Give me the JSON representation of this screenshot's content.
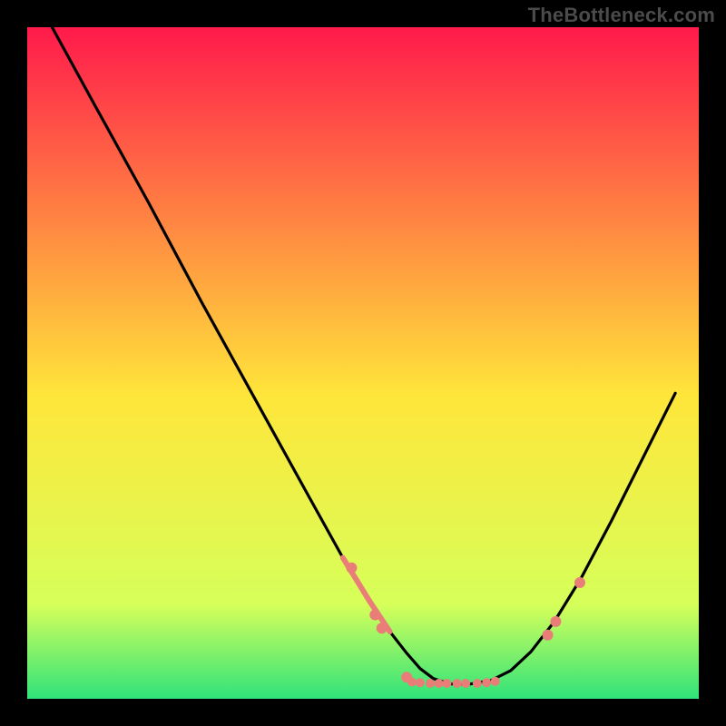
{
  "watermark": "TheBottleneck.com",
  "chart_data": {
    "type": "line",
    "title": "",
    "xlabel": "",
    "ylabel": "",
    "xlim": [
      0,
      100
    ],
    "ylim": [
      0,
      100
    ],
    "grid": false,
    "legend": false,
    "background_gradient_top": "#ff1a4b",
    "background_gradient_mid": "#ffe63a",
    "background_gradient_bottom": "#2fe37a",
    "curve_color": "#000000",
    "curve": [
      {
        "x": 3.7,
        "y": 100.0
      },
      {
        "x": 10.0,
        "y": 88.5
      },
      {
        "x": 18.0,
        "y": 74.0
      },
      {
        "x": 26.0,
        "y": 59.0
      },
      {
        "x": 34.0,
        "y": 44.5
      },
      {
        "x": 42.0,
        "y": 30.0
      },
      {
        "x": 47.0,
        "y": 21.0
      },
      {
        "x": 51.0,
        "y": 14.5
      },
      {
        "x": 54.0,
        "y": 10.0
      },
      {
        "x": 56.5,
        "y": 6.8
      },
      {
        "x": 58.5,
        "y": 4.5
      },
      {
        "x": 60.5,
        "y": 3.0
      },
      {
        "x": 63.0,
        "y": 2.2
      },
      {
        "x": 66.0,
        "y": 2.2
      },
      {
        "x": 69.0,
        "y": 2.7
      },
      {
        "x": 72.0,
        "y": 4.2
      },
      {
        "x": 75.0,
        "y": 7.0
      },
      {
        "x": 78.5,
        "y": 11.5
      },
      {
        "x": 82.5,
        "y": 18.0
      },
      {
        "x": 87.0,
        "y": 26.5
      },
      {
        "x": 91.5,
        "y": 35.5
      },
      {
        "x": 96.5,
        "y": 45.5
      }
    ],
    "scatter_color": "#e97d78",
    "scatter_points": [
      {
        "x": 48.3,
        "y": 19.5,
        "r": 6
      },
      {
        "x": 51.8,
        "y": 12.5,
        "r": 6
      },
      {
        "x": 52.8,
        "y": 10.5,
        "r": 6
      },
      {
        "x": 56.5,
        "y": 3.2,
        "r": 6
      },
      {
        "x": 57.3,
        "y": 2.5,
        "r": 5
      },
      {
        "x": 58.5,
        "y": 2.4,
        "r": 5
      },
      {
        "x": 60.0,
        "y": 2.3,
        "r": 5
      },
      {
        "x": 61.3,
        "y": 2.3,
        "r": 5
      },
      {
        "x": 62.5,
        "y": 2.3,
        "r": 5
      },
      {
        "x": 64.0,
        "y": 2.3,
        "r": 5
      },
      {
        "x": 65.3,
        "y": 2.3,
        "r": 5
      },
      {
        "x": 67.0,
        "y": 2.3,
        "r": 5
      },
      {
        "x": 68.4,
        "y": 2.4,
        "r": 5
      },
      {
        "x": 69.7,
        "y": 2.6,
        "r": 5
      },
      {
        "x": 77.5,
        "y": 9.5,
        "r": 6
      },
      {
        "x": 78.7,
        "y": 11.5,
        "r": 6
      },
      {
        "x": 82.3,
        "y": 17.3,
        "r": 6
      }
    ]
  }
}
